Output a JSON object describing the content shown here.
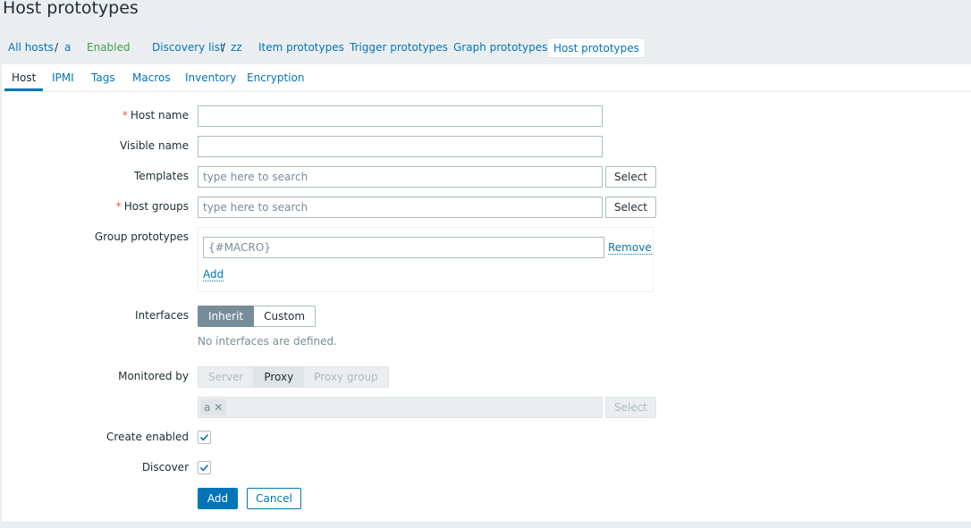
{
  "page": {
    "title": "Host prototypes"
  },
  "breadcrumb": {
    "all_hosts": "All hosts",
    "separator": "/",
    "host": "a",
    "status": "Enabled",
    "discovery_list": "Discovery list",
    "discovery_rule": "zz",
    "item_prototypes": "Item prototypes",
    "trigger_prototypes": "Trigger prototypes",
    "graph_prototypes": "Graph prototypes",
    "host_prototypes": "Host prototypes"
  },
  "tabs": {
    "host": "Host",
    "ipmi": "IPMI",
    "tags": "Tags",
    "macros": "Macros",
    "inventory": "Inventory",
    "encryption": "Encryption",
    "active": "Host"
  },
  "form": {
    "required_mark": "*",
    "host_name": {
      "label": "Host name",
      "value": ""
    },
    "visible_name": {
      "label": "Visible name",
      "value": ""
    },
    "templates": {
      "label": "Templates",
      "placeholder": "type here to search",
      "select_label": "Select"
    },
    "host_groups": {
      "label": "Host groups",
      "placeholder": "type here to search",
      "select_label": "Select"
    },
    "group_prototypes": {
      "label": "Group prototypes",
      "placeholder": "{#MACRO}",
      "remove_label": "Remove",
      "add_label": "Add"
    },
    "interfaces": {
      "label": "Interfaces",
      "options": [
        "Inherit",
        "Custom"
      ],
      "selected": "Inherit",
      "hint": "No interfaces are defined."
    },
    "monitored_by": {
      "label": "Monitored by",
      "options": [
        "Server",
        "Proxy",
        "Proxy group"
      ],
      "selected": "Proxy",
      "proxy_tag": "a",
      "tag_remove": "✕",
      "select_label": "Select"
    },
    "create_enabled": {
      "label": "Create enabled",
      "checked": true
    },
    "discover": {
      "label": "Discover",
      "checked": true
    },
    "add_button": "Add",
    "cancel_button": "Cancel"
  },
  "colors": {
    "link": "#0275b8",
    "status_enabled": "#429e47",
    "required": "#e45959",
    "primary_button": "#0275b8",
    "selected_segment": "#768d99",
    "background": "#ebeef0"
  }
}
